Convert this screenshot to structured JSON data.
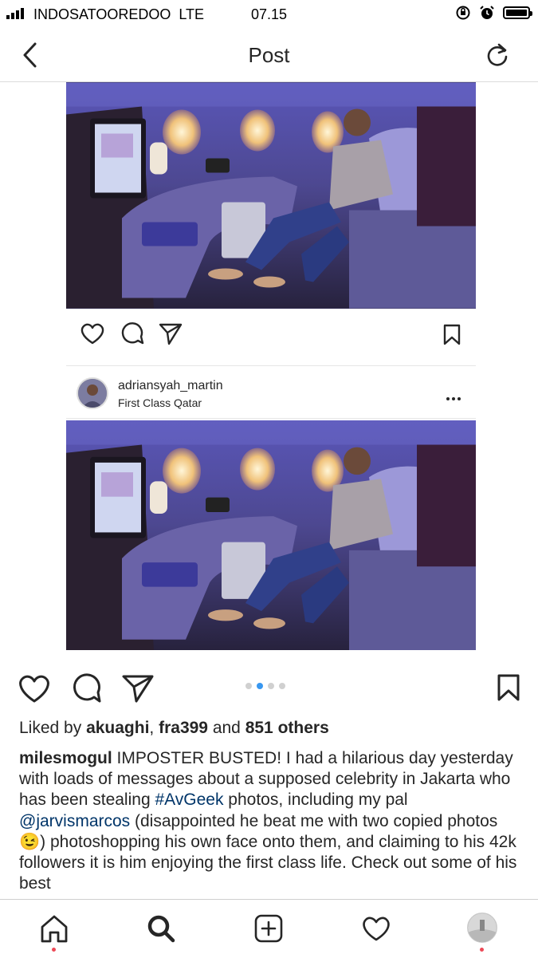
{
  "status_bar": {
    "carrier": "INDOSATOOREDOO",
    "network": "LTE",
    "time": "07.15"
  },
  "header": {
    "title": "Post",
    "back_icon": "chevron-left-icon",
    "refresh_icon": "refresh-icon"
  },
  "embedded_post": {
    "username": "adriansyah_martin",
    "location": "First Class Qatar"
  },
  "post": {
    "pager": {
      "count": 4,
      "active_index": 1
    },
    "likes_prefix": "Liked by ",
    "likes_user1": "akuaghi",
    "likes_sep": ", ",
    "likes_user2": "fra399",
    "likes_and": " and ",
    "likes_count": "851 others",
    "caption_user": "milesmogul",
    "caption_part1": " IMPOSTER BUSTED! I had a hilarious day yesterday with loads of messages about a supposed celebrity in Jakarta who has been stealing ",
    "caption_hashtag": "#AvGeek",
    "caption_part2": " photos, including my pal ",
    "caption_mention": "@jarvismarcos",
    "caption_part3": " (disappointed he beat me with two copied photos 😉) photoshopping his own face onto them, and claiming to his 42k followers it is him enjoying the first class life. Check out some of his best"
  },
  "colors": {
    "accent_blue": "#3897f0",
    "link_blue": "#003569",
    "notification_red": "#ed4956",
    "text": "#262626"
  },
  "tab_bar": {
    "items": [
      "home-icon",
      "search-icon",
      "new-post-icon",
      "activity-icon",
      "profile-avatar"
    ]
  }
}
